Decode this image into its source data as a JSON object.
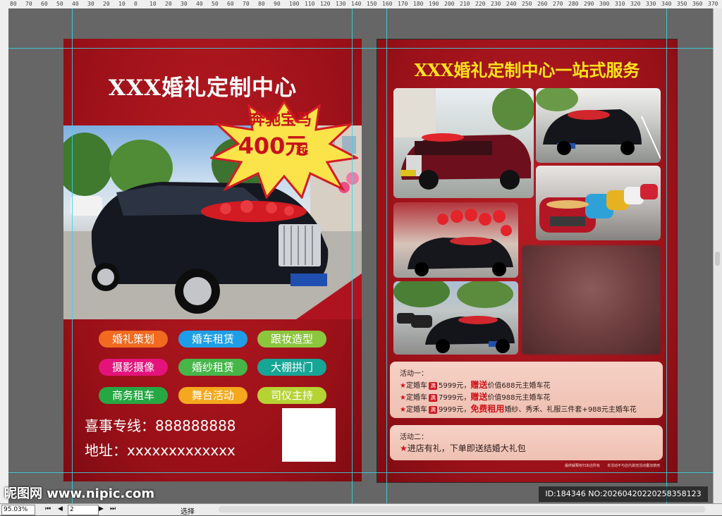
{
  "ruler": {
    "top_ticks": [
      "80",
      "70",
      "60",
      "50",
      "40",
      "30",
      "20",
      "10",
      "0",
      "10",
      "20",
      "30",
      "40",
      "50",
      "60",
      "70",
      "80",
      "90",
      "100",
      "110",
      "120",
      "130",
      "140",
      "150",
      "160",
      "170",
      "180",
      "190",
      "200",
      "210",
      "220",
      "230",
      "240",
      "250",
      "260",
      "270",
      "280",
      "290",
      "300",
      "310",
      "320",
      "330",
      "340",
      "350",
      "360",
      "370"
    ]
  },
  "left_page": {
    "title": "XXX婚礼定制中心",
    "burst_line1": "奔驰宝马",
    "burst_line2": "400元",
    "burst_suffix": "起",
    "services": [
      {
        "label": "婚礼策划",
        "color": "#f26a1f"
      },
      {
        "label": "婚车租赁",
        "color": "#1f9ee8"
      },
      {
        "label": "跟妆造型",
        "color": "#8cc63f"
      },
      {
        "label": "摄影摄像",
        "color": "#e4137b"
      },
      {
        "label": "婚纱租赁",
        "color": "#46b649"
      },
      {
        "label": "大棚拱门",
        "color": "#17a596"
      },
      {
        "label": "商务租车",
        "color": "#27a744"
      },
      {
        "label": "舞台活动",
        "color": "#f5a81d"
      },
      {
        "label": "司仪主持",
        "color": "#b6d334"
      }
    ],
    "phone_label": "喜事专线：",
    "phone": "888888888",
    "address_label": "地址：",
    "address": "xxxxxxxxxxxxx"
  },
  "right_page": {
    "title": "XXX婚礼定制中心一站式服务",
    "promo1": {
      "head": "活动一：",
      "rows": [
        {
          "prefix": "定婚车",
          "tag": "满",
          "amount": "5999元，",
          "highlight": "赠送",
          "rest": "价值688元主婚车花"
        },
        {
          "prefix": "定婚车",
          "tag": "满",
          "amount": "7999元，",
          "highlight": "赠送",
          "rest": "价值988元主婚车花"
        },
        {
          "prefix": "定婚车",
          "tag": "满",
          "amount": "9999元，",
          "highlight": "免费租用",
          "rest": "婚纱、秀禾、礼服三件套+988元主婚车花"
        }
      ]
    },
    "promo2": {
      "head": "活动二：",
      "row": "进店有礼，下单即送结婚大礼包"
    },
    "footnote": "最终解释权归本店所有　　本活动不与店内其他活动叠加使用"
  },
  "watermark": {
    "brand": "昵图网 www.nipic.com",
    "id": "ID:184346 NO:20260420220258358123"
  },
  "statusbar": {
    "zoom": "95.03%",
    "page": "2",
    "nav_first": "⏮",
    "nav_prev": "◀",
    "nav_next": "▶",
    "nav_last": "⏭",
    "mode": "选择"
  },
  "colors": {
    "page_red": "#a3121a",
    "title_yellow": "#ffe21a",
    "guide_cyan": "#3fd3e0"
  }
}
